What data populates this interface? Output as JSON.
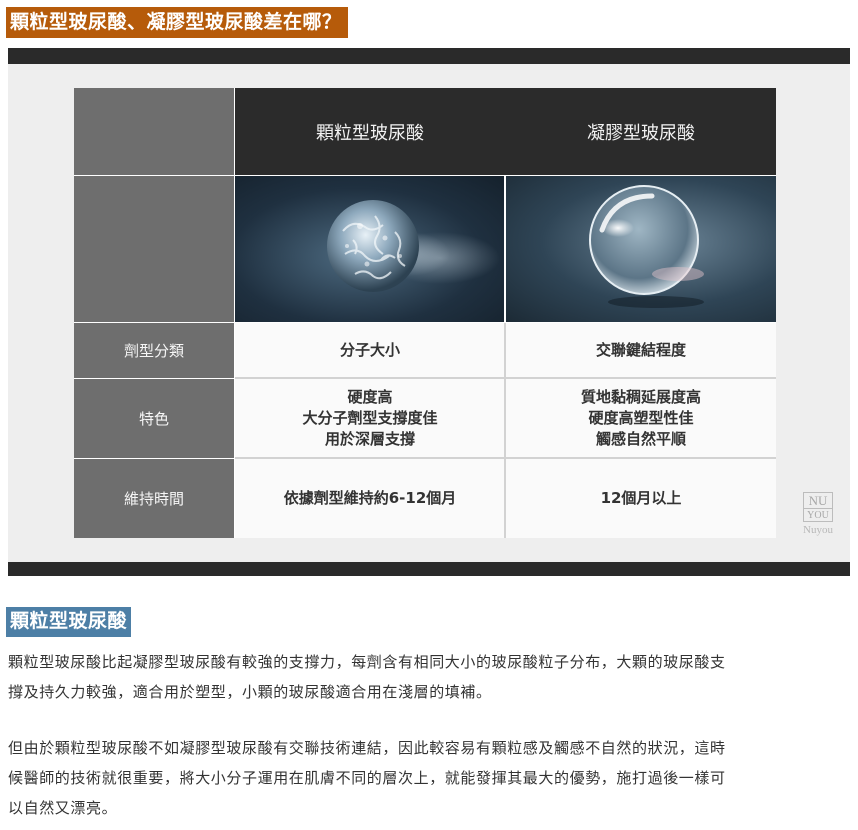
{
  "heading1": "顆粒型玻尿酸、凝膠型玻尿酸差在哪？",
  "table": {
    "col1_header": "顆粒型玻尿酸",
    "col2_header": "凝膠型玻尿酸",
    "rows": [
      {
        "label": "劑型分類",
        "col1": [
          "分子大小"
        ],
        "col2": [
          "交聯鍵結程度"
        ]
      },
      {
        "label": "特色",
        "col1": [
          "硬度高",
          "大分子劑型支撐度佳",
          "用於深層支撐"
        ],
        "col2": [
          "質地黏稠延展度高",
          "硬度高塑型性佳",
          "觸感自然平順"
        ]
      },
      {
        "label": "維持時間",
        "col1": [
          "依據劑型維持約6-12個月"
        ],
        "col2": [
          "12個月以上"
        ]
      }
    ]
  },
  "logo": {
    "box_top": "NU",
    "box_bottom": "YOU",
    "name": "Nuyou"
  },
  "heading2": "顆粒型玻尿酸",
  "paragraph1_lines": [
    "顆粒型玻尿酸比起凝膠型玻尿酸有較強的支撐力，每劑含有相同大小的玻尿酸粒子分布，大顆的玻尿酸支",
    "撐及持久力較強，適合用於塑型，小顆的玻尿酸適合用在淺層的填補。"
  ],
  "paragraph2_lines": [
    "但由於顆粒型玻尿酸不如凝膠型玻尿酸有交聯技術連結，因此較容易有顆粒感及觸感不自然的狀況，這時",
    "候醫師的技術就很重要，將大小分子運用在肌膚不同的層次上，就能發揮其最大的優勢，施打過後一樣可",
    "以自然又漂亮。"
  ],
  "colors": {
    "heading1_bg": "#b65b0a",
    "heading2_bg": "#4d7fa6",
    "table_header_dark": "#2b2b2b",
    "row_header_gray": "#6e6e6e"
  }
}
